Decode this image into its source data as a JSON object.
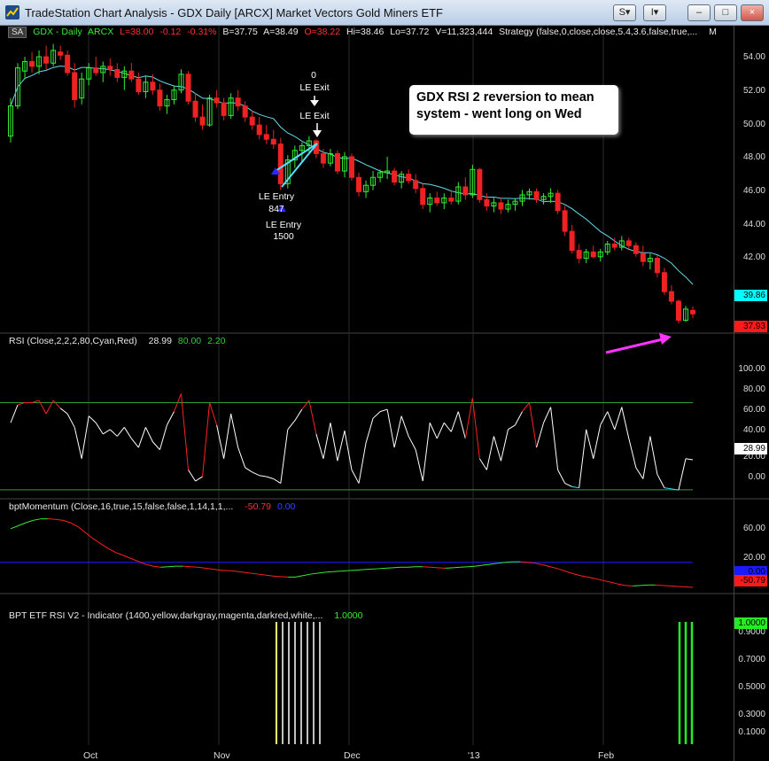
{
  "window": {
    "title": "TradeStation Chart Analysis - GDX Daily [ARCX] Market Vectors Gold Miners ETF",
    "buttons": [
      "S",
      "I",
      "–",
      "□",
      "×"
    ]
  },
  "price_panel": {
    "badge": "SA",
    "symbol": "GDX - Daily",
    "exchange": "ARCX",
    "last": "L=38.00",
    "change": "-0.12",
    "change_pct": "-0.31%",
    "bid": "B=37.75",
    "ask": "A=38.49",
    "open": "O=38.22",
    "high": "Hi=38.46",
    "low": "Lo=37.72",
    "volume": "V=11,323,444",
    "strategy": "Strategy (false,0,close,close,5.4,3.6,false,true,...",
    "strategy_flag": "M",
    "y_ticks": [
      "54.00",
      "52.00",
      "50.00",
      "48.00",
      "46.00",
      "44.00",
      "42.00"
    ],
    "avg_value": "39.86",
    "last_value": "37.93",
    "colors": {
      "up": "#33ee33",
      "down": "#ee2222",
      "avg": "#66d9ee",
      "avg_badge": "#00ffff",
      "last_badge": "#ff1a1a"
    }
  },
  "annotations": {
    "exit_qty": "0",
    "exit_label1": "LE Exit",
    "exit_label2": "LE Exit",
    "entry_label1": "LE Entry",
    "entry_qty1": "847",
    "entry_label2": "LE Entry",
    "entry_qty2": "1500",
    "callout_line1": "GDX RSI 2 reversion to mean",
    "callout_line2": "system - went long on Wed",
    "arrow_color": "#ff33ff"
  },
  "rsi_panel": {
    "label": "RSI (Close,2,2,2,80,Cyan,Red)",
    "value": "28.99",
    "ob": "80.00",
    "os": "2.20",
    "y_ticks": [
      "100.00",
      "80.00",
      "60.00",
      "40.00",
      "20.00",
      "0.00"
    ],
    "last_value": "28.99"
  },
  "momentum_panel": {
    "label": "bptMomentum (Close,16,true,15,false,false,1,14,1,1,...",
    "value": "-50.79",
    "zero": "0.00",
    "y_ticks": [
      "60.00",
      "20.00",
      "-20.00"
    ],
    "zero_badge": "0.00",
    "last_value": "-50.79"
  },
  "etf_panel": {
    "label": "BPT ETF RSI V2 - Indicator (1400,yellow,darkgray,magenta,darkred,white,...",
    "value": "1.0000",
    "y_ticks": [
      "0.9000",
      "0.7000",
      "0.5000",
      "0.3000",
      "0.1000"
    ],
    "last_value": "1.0000"
  },
  "x_axis": {
    "labels": [
      "Oct",
      "Nov",
      "Dec",
      "'13",
      "Feb"
    ]
  },
  "chart_data": {
    "type": "candlestick",
    "title": "GDX Daily [ARCX] Market Vectors Gold Miners ETF",
    "ylim": [
      36.9,
      55.6
    ],
    "x_labels": [
      "Oct",
      "Nov",
      "Dec",
      "'13",
      "Feb"
    ],
    "ohlc": [
      [
        49.2,
        51.6,
        48.8,
        51.1
      ],
      [
        51.1,
        53.8,
        50.9,
        53.5
      ],
      [
        53.3,
        54.2,
        52.8,
        53.9
      ],
      [
        53.9,
        54.5,
        53.2,
        53.6
      ],
      [
        53.6,
        54.6,
        53.1,
        54.2
      ],
      [
        54.2,
        54.9,
        53.4,
        53.8
      ],
      [
        53.8,
        55.0,
        53.6,
        54.6
      ],
      [
        54.5,
        54.9,
        54.0,
        54.3
      ],
      [
        54.3,
        54.6,
        53.0,
        53.2
      ],
      [
        53.2,
        53.8,
        51.0,
        51.5
      ],
      [
        51.6,
        53.2,
        51.2,
        52.8
      ],
      [
        52.8,
        53.8,
        52.4,
        53.5
      ],
      [
        53.5,
        54.2,
        53.0,
        53.2
      ],
      [
        53.2,
        53.9,
        52.6,
        53.6
      ],
      [
        53.6,
        54.1,
        53.0,
        53.4
      ],
      [
        53.4,
        53.8,
        52.6,
        52.9
      ],
      [
        52.9,
        53.6,
        52.1,
        53.3
      ],
      [
        53.3,
        53.8,
        52.6,
        52.8
      ],
      [
        52.8,
        53.2,
        51.8,
        52.0
      ],
      [
        52.0,
        53.0,
        51.6,
        52.6
      ],
      [
        52.6,
        53.1,
        51.8,
        52.1
      ],
      [
        52.1,
        52.5,
        50.8,
        51.1
      ],
      [
        51.1,
        51.8,
        50.6,
        51.5
      ],
      [
        51.5,
        52.4,
        51.2,
        52.1
      ],
      [
        52.1,
        53.4,
        51.9,
        53.1
      ],
      [
        53.1,
        53.3,
        51.2,
        51.4
      ],
      [
        51.4,
        51.9,
        50.1,
        50.4
      ],
      [
        50.4,
        51.2,
        49.6,
        49.9
      ],
      [
        49.9,
        51.8,
        49.8,
        51.6
      ],
      [
        51.6,
        52.1,
        51.0,
        51.3
      ],
      [
        51.3,
        51.6,
        50.2,
        50.5
      ],
      [
        50.5,
        51.9,
        50.3,
        51.6
      ],
      [
        51.6,
        52.1,
        50.8,
        51.1
      ],
      [
        51.1,
        51.4,
        50.1,
        50.4
      ],
      [
        50.4,
        50.8,
        49.6,
        49.9
      ],
      [
        49.9,
        50.4,
        49.0,
        49.3
      ],
      [
        49.3,
        49.9,
        48.7,
        49.0
      ],
      [
        49.0,
        49.6,
        48.4,
        48.7
      ],
      [
        48.7,
        49.1,
        45.8,
        46.2
      ],
      [
        46.2,
        48.0,
        45.9,
        47.7
      ],
      [
        47.7,
        48.6,
        47.2,
        48.3
      ],
      [
        48.3,
        48.8,
        47.6,
        48.6
      ],
      [
        48.6,
        49.2,
        48.2,
        48.9
      ],
      [
        48.9,
        49.0,
        47.8,
        48.1
      ],
      [
        48.1,
        48.4,
        47.2,
        47.5
      ],
      [
        47.5,
        48.4,
        47.3,
        48.1
      ],
      [
        48.1,
        48.3,
        46.8,
        47.0
      ],
      [
        47.0,
        48.2,
        46.6,
        47.9
      ],
      [
        47.9,
        48.1,
        46.4,
        46.6
      ],
      [
        46.6,
        46.9,
        45.4,
        45.7
      ],
      [
        45.7,
        46.4,
        45.3,
        46.1
      ],
      [
        46.1,
        47.0,
        45.8,
        46.6
      ],
      [
        46.6,
        47.1,
        46.3,
        46.9
      ],
      [
        46.9,
        47.9,
        46.5,
        47.0
      ],
      [
        47.0,
        47.2,
        46.1,
        46.3
      ],
      [
        46.3,
        47.0,
        45.9,
        46.8
      ],
      [
        46.8,
        47.1,
        46.2,
        46.4
      ],
      [
        46.4,
        46.8,
        45.6,
        45.9
      ],
      [
        45.9,
        46.2,
        44.6,
        44.9
      ],
      [
        44.9,
        45.6,
        44.4,
        45.3
      ],
      [
        45.3,
        45.7,
        44.8,
        45.0
      ],
      [
        45.0,
        45.6,
        44.6,
        45.3
      ],
      [
        45.3,
        45.8,
        44.9,
        45.1
      ],
      [
        45.1,
        46.3,
        44.9,
        46.0
      ],
      [
        46.0,
        46.6,
        45.2,
        45.5
      ],
      [
        45.5,
        47.4,
        45.3,
        47.1
      ],
      [
        47.1,
        47.2,
        45.0,
        45.2
      ],
      [
        45.2,
        45.6,
        44.5,
        44.8
      ],
      [
        44.8,
        45.3,
        44.4,
        45.0
      ],
      [
        45.0,
        45.3,
        44.3,
        44.6
      ],
      [
        44.6,
        45.2,
        44.4,
        44.9
      ],
      [
        44.9,
        45.3,
        44.5,
        45.1
      ],
      [
        45.1,
        45.8,
        44.8,
        45.5
      ],
      [
        45.5,
        45.9,
        45.2,
        45.7
      ],
      [
        45.7,
        45.9,
        45.0,
        45.2
      ],
      [
        45.2,
        45.6,
        44.9,
        45.4
      ],
      [
        45.4,
        45.9,
        45.0,
        45.6
      ],
      [
        45.6,
        45.8,
        44.3,
        44.5
      ],
      [
        44.5,
        44.8,
        42.9,
        43.2
      ],
      [
        43.2,
        43.6,
        41.8,
        42.0
      ],
      [
        42.0,
        42.4,
        41.2,
        41.5
      ],
      [
        41.5,
        42.1,
        41.2,
        41.9
      ],
      [
        41.9,
        42.3,
        41.5,
        41.6
      ],
      [
        41.6,
        42.1,
        41.3,
        41.9
      ],
      [
        41.9,
        42.6,
        41.7,
        42.4
      ],
      [
        42.4,
        42.8,
        42.0,
        42.2
      ],
      [
        42.2,
        42.9,
        42.0,
        42.6
      ],
      [
        42.6,
        42.8,
        42.1,
        42.3
      ],
      [
        42.3,
        42.5,
        41.6,
        41.8
      ],
      [
        41.8,
        42.3,
        41.0,
        41.3
      ],
      [
        41.3,
        41.8,
        40.8,
        41.5
      ],
      [
        41.5,
        41.7,
        40.3,
        40.6
      ],
      [
        40.6,
        40.9,
        39.2,
        39.4
      ],
      [
        39.4,
        39.8,
        38.6,
        38.8
      ],
      [
        38.8,
        38.9,
        37.4,
        37.6
      ],
      [
        37.6,
        38.5,
        37.5,
        38.3
      ],
      [
        38.22,
        38.46,
        37.72,
        38.0
      ]
    ],
    "avg_end": 39.86,
    "rsi": [
      62,
      78,
      80,
      80,
      82,
      70,
      82,
      75,
      70,
      58,
      30,
      68,
      62,
      52,
      56,
      50,
      58,
      48,
      40,
      58,
      45,
      38,
      60,
      72,
      88,
      20,
      10,
      14,
      80,
      60,
      30,
      70,
      40,
      22,
      18,
      15,
      14,
      12,
      8,
      56,
      64,
      74,
      82,
      52,
      30,
      62,
      28,
      55,
      20,
      8,
      44,
      66,
      72,
      74,
      40,
      68,
      50,
      38,
      10,
      62,
      48,
      62,
      54,
      72,
      48,
      84,
      30,
      20,
      50,
      28,
      56,
      60,
      72,
      80,
      40,
      62,
      76,
      20,
      8,
      5,
      4,
      56,
      30,
      60,
      72,
      56,
      76,
      48,
      22,
      12,
      50,
      16,
      4,
      3,
      2,
      30,
      28.99
    ],
    "rsi_levels": {
      "overbought": 80,
      "oversold": 2.2,
      "ylim": [
        -5,
        112
      ]
    },
    "momentum": [
      68,
      74,
      80,
      85,
      88,
      88,
      87,
      85,
      80,
      72,
      60,
      48,
      38,
      28,
      20,
      14,
      8,
      2,
      -4,
      -8,
      -10,
      -9,
      -8,
      -8,
      -9,
      -10,
      -12,
      -14,
      -16,
      -17,
      -18,
      -20,
      -22,
      -24,
      -26,
      -28,
      -29,
      -30,
      -30,
      -27,
      -24,
      -22,
      -20,
      -19,
      -18,
      -17,
      -16,
      -15,
      -14,
      -13,
      -12,
      -11,
      -10,
      -10,
      -9,
      -9,
      -10,
      -11,
      -12,
      -11,
      -10,
      -9,
      -8,
      -6,
      -4,
      -2,
      0,
      1,
      1,
      0,
      -2,
      -5,
      -9,
      -13,
      -18,
      -23,
      -27,
      -30,
      -33,
      -37,
      -40,
      -44,
      -47,
      -48,
      -47,
      -46,
      -46,
      -47,
      -48,
      -49,
      -50,
      -50.79
    ],
    "momentum_zero": 0.0,
    "momentum_ylim": [
      -58,
      100
    ],
    "etf_signal_indices": [
      26,
      27,
      28,
      29,
      30,
      31,
      32,
      33
    ],
    "etf_signal_last": [
      93,
      94,
      95
    ],
    "etf_value": 1.0
  }
}
